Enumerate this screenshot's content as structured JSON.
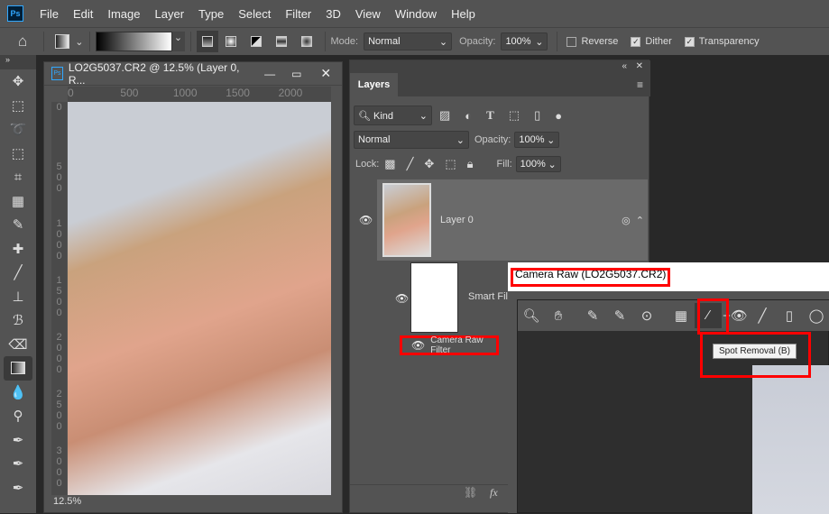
{
  "menu": {
    "items": [
      "File",
      "Edit",
      "Image",
      "Layer",
      "Type",
      "Select",
      "Filter",
      "3D",
      "View",
      "Window",
      "Help"
    ]
  },
  "options": {
    "mode_label": "Mode:",
    "mode_value": "Normal",
    "opacity_label": "Opacity:",
    "opacity_value": "100%",
    "reverse": "Reverse",
    "dither": "Dither",
    "transparency": "Transparency",
    "reverse_checked": false,
    "dither_checked": true,
    "transparency_checked": true
  },
  "document": {
    "title": "LO2G5037.CR2 @ 12.5% (Layer 0, R...",
    "ruler_h": [
      "0",
      "500",
      "1000",
      "1500",
      "2000"
    ],
    "ruler_v": [
      "0",
      "500",
      "1000",
      "1500",
      "2000",
      "2500",
      "3000"
    ],
    "zoom": "12.5%"
  },
  "layers": {
    "tab": "Layers",
    "filter_kind": "Kind",
    "blend_mode": "Normal",
    "opacity_label": "Opacity:",
    "opacity_value": "100%",
    "lock_label": "Lock:",
    "fill_label": "Fill:",
    "fill_value": "100%",
    "layer_name": "Layer 0",
    "smart_filters": "Smart Filters",
    "filter_name": "Camera Raw Filter"
  },
  "camera_raw": {
    "title": "Camera Raw (LO2G5037.CR2)",
    "tooltip": "Spot Removal (B)"
  }
}
